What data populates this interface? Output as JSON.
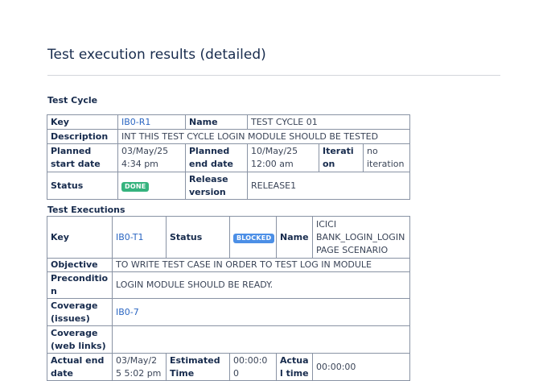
{
  "title": "Test execution results (detailed)",
  "test_cycle": {
    "section_title": "Test Cycle",
    "labels": {
      "key": "Key",
      "name": "Name",
      "description": "Description",
      "planned_start": "Planned start date",
      "planned_end": "Planned end date",
      "iteration": "Iteration",
      "status": "Status",
      "release": "Release version"
    },
    "key": "IB0-R1",
    "name": "TEST CYCLE 01",
    "description": "INT THIS TEST CYCLE LOGIN MODULE SHOULD BE TESTED",
    "planned_start": "03/May/25 4:34 pm",
    "planned_end": "10/May/25 12:00 am",
    "iteration": "no iteration",
    "status": "DONE",
    "status_color": "#36b37e",
    "release": "RELEASE1"
  },
  "test_executions": {
    "section_title": "Test Executions",
    "labels": {
      "key": "Key",
      "status": "Status",
      "name": "Name",
      "objective": "Objective",
      "precondition": "Precondition",
      "coverage_issues": "Coverage (issues)",
      "coverage_web": "Coverage (web links)",
      "actual_end": "Actual end date",
      "estimated_time": "Estimated Time",
      "actual_time": "Actual time"
    },
    "key": "IB0-T1",
    "status": "BLOCKED",
    "status_color": "#4c8fe6",
    "name": "ICICI BANK_LOGIN_LOGIN PAGE SCENARIO",
    "objective": "TO WRITE TEST CASE IN ORDER TO TEST LOG IN MODULE",
    "precondition": "LOGIN MODULE SHOULD BE READY.",
    "coverage_issues": "IB0-7",
    "coverage_web": "",
    "actual_end": "03/May/25 5:02 pm",
    "estimated_time": "00:00:00",
    "actual_time": "00:00:00"
  },
  "colors": {
    "link": "#2b66c2",
    "border": "#8993a4",
    "heading": "#172b4d"
  }
}
